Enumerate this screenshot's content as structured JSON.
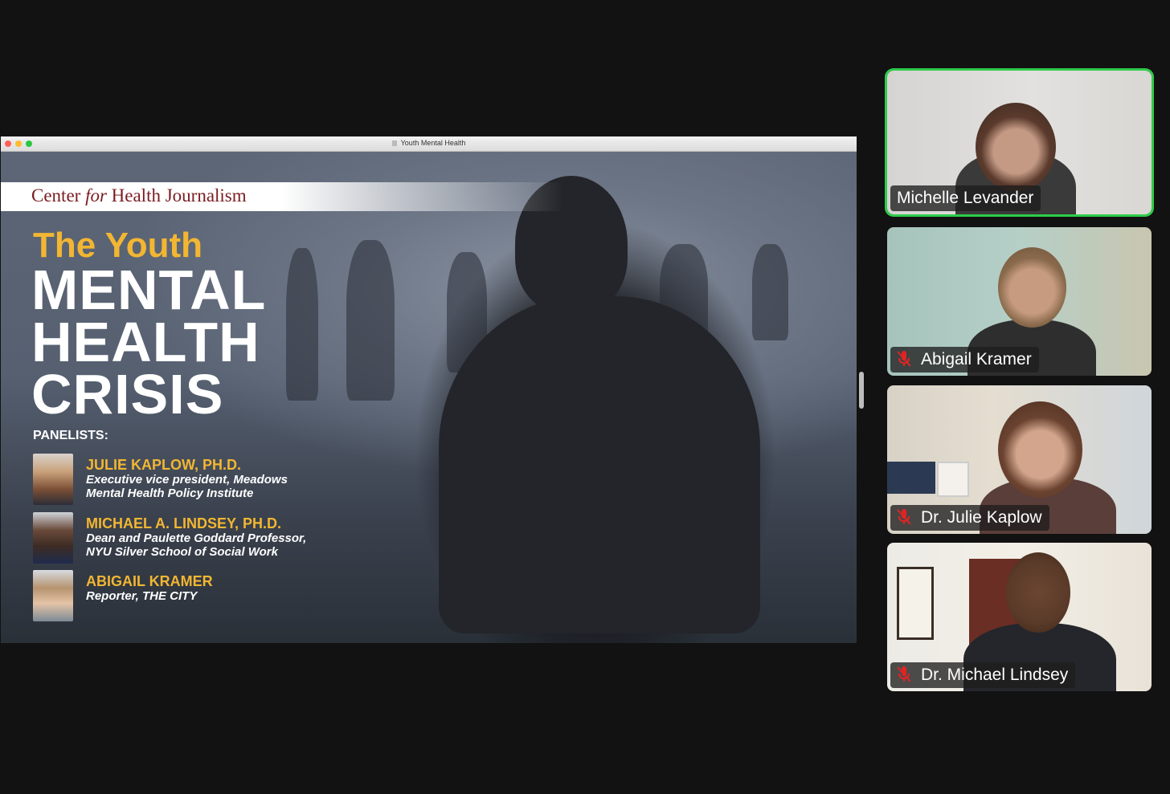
{
  "share": {
    "window_title": "Youth Mental Health",
    "slide": {
      "brand_pre": "Center ",
      "brand_for": "for",
      "brand_post": " Health Journalism",
      "title_youth": "The Youth",
      "title_line1": "MENTAL",
      "title_line2": "HEALTH",
      "title_line3": "CRISIS",
      "panelists_label": "PANELISTS:",
      "panelists": [
        {
          "name": "JULIE KAPLOW, PH.D.",
          "desc1": "Executive vice president, Meadows",
          "desc2": "Mental Health Policy Institute"
        },
        {
          "name": "MICHAEL A. LINDSEY, PH.D.",
          "desc1": "Dean and Paulette Goddard Professor,",
          "desc2": "NYU Silver School of Social Work"
        },
        {
          "name": "ABIGAIL KRAMER",
          "desc1": "Reporter, THE CITY",
          "desc2": ""
        }
      ]
    }
  },
  "participants": [
    {
      "name": "Michelle Levander",
      "muted": false,
      "active": true
    },
    {
      "name": "Abigail Kramer",
      "muted": true,
      "active": false
    },
    {
      "name": "Dr. Julie Kaplow",
      "muted": true,
      "active": false
    },
    {
      "name": "Dr. Michael Lindsey",
      "muted": true,
      "active": false
    }
  ],
  "colors": {
    "active_speaker_border": "#2ecc4a",
    "mute_icon": "#e02424",
    "title_gold": "#f2b632",
    "brand_maroon": "#7a1c21"
  }
}
